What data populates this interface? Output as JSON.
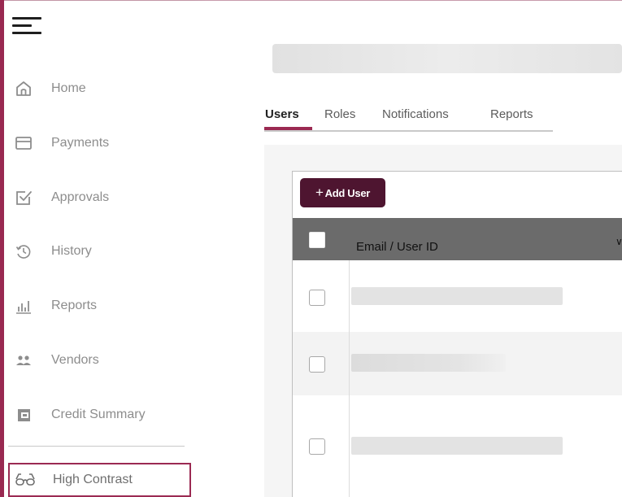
{
  "sidebar": {
    "menu_icon": "hamburger-menu-icon",
    "items": [
      {
        "label": "Home",
        "icon": "home-icon"
      },
      {
        "label": "Payments",
        "icon": "card-icon"
      },
      {
        "label": "Approvals",
        "icon": "approval-check-icon"
      },
      {
        "label": "History",
        "icon": "history-icon"
      },
      {
        "label": "Reports",
        "icon": "bar-chart-icon"
      },
      {
        "label": "Vendors",
        "icon": "people-icon"
      },
      {
        "label": "Credit Summary",
        "icon": "wallet-icon"
      }
    ],
    "high_contrast": {
      "label": "High Contrast",
      "icon": "glasses-icon"
    }
  },
  "tabs": [
    {
      "label": "Users",
      "active": true
    },
    {
      "label": "Roles",
      "active": false
    },
    {
      "label": "Notifications",
      "active": false
    },
    {
      "label": "Reports",
      "active": false
    }
  ],
  "toolbar": {
    "add_user_label": "Add User",
    "add_user_icon": "plus-icon"
  },
  "table": {
    "columns": [
      {
        "label": "Email / User ID",
        "sort_icon": "chevron-down-icon"
      }
    ],
    "rows": [
      {
        "loading": true,
        "selected": false
      },
      {
        "loading": true,
        "selected": false
      },
      {
        "loading": true,
        "selected": false
      }
    ]
  },
  "colors": {
    "accent": "#9b2a52",
    "button_bg": "#4e1530",
    "header_bg": "#6b6b6b",
    "nav_text": "#8d8d8d"
  }
}
